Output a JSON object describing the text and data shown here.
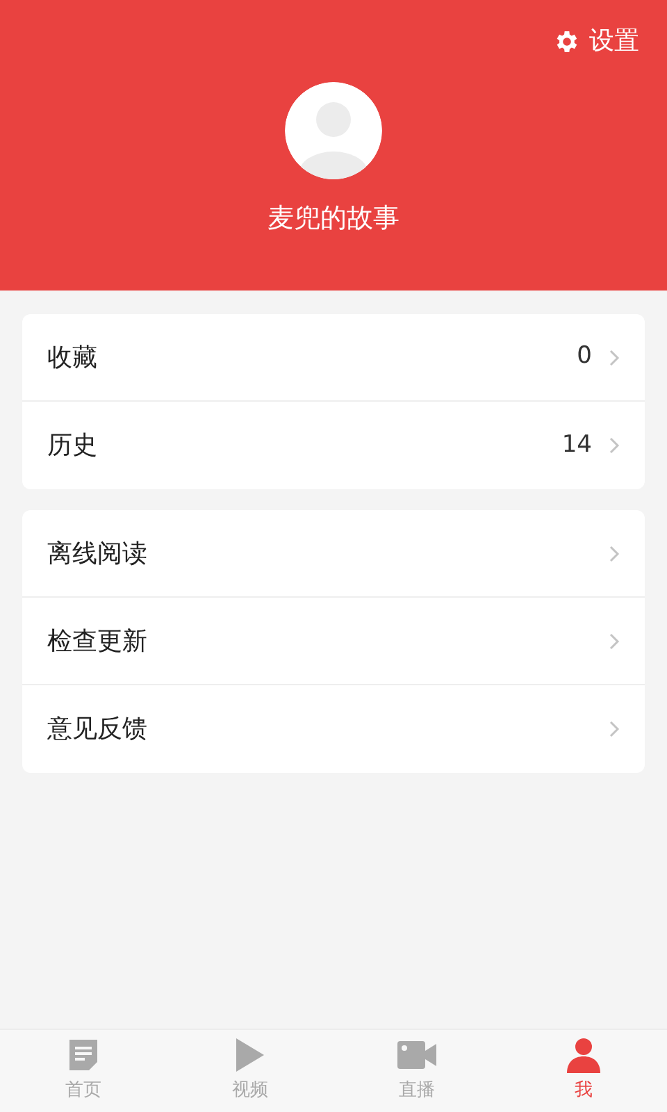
{
  "header": {
    "settings_label": "设置",
    "username": "麦兜的故事"
  },
  "menu_groups": [
    {
      "items": [
        {
          "label": "收藏",
          "value": "0"
        },
        {
          "label": "历史",
          "value": "14"
        }
      ]
    },
    {
      "items": [
        {
          "label": "离线阅读"
        },
        {
          "label": "检查更新"
        },
        {
          "label": "意见反馈"
        }
      ]
    }
  ],
  "tab_bar": [
    {
      "kind": "doc",
      "label": "首页",
      "selected": false
    },
    {
      "kind": "play",
      "label": "视频",
      "selected": false
    },
    {
      "kind": "camera",
      "label": "直播",
      "selected": false
    },
    {
      "kind": "person",
      "label": "我",
      "selected": true
    }
  ]
}
